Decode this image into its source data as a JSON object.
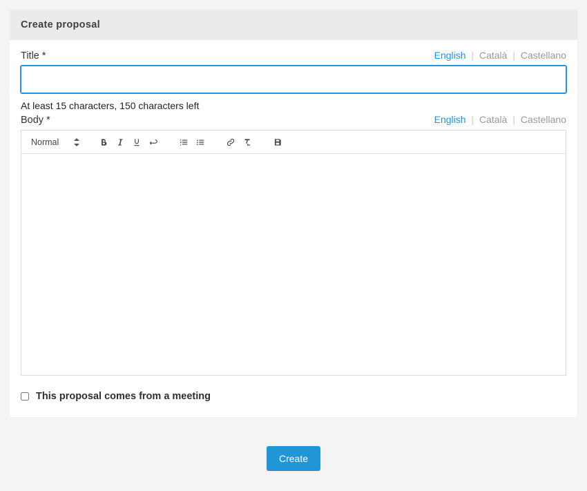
{
  "header": {
    "title": "Create proposal"
  },
  "languages": {
    "items": [
      {
        "label": "English",
        "active": true
      },
      {
        "label": "Català",
        "active": false
      },
      {
        "label": "Castellano",
        "active": false
      }
    ]
  },
  "title_field": {
    "label": "Title *",
    "value": "",
    "help_text": "At least 15 characters, 150 characters left"
  },
  "body_field": {
    "label": "Body *",
    "format_select": "Normal",
    "value": ""
  },
  "meeting_checkbox": {
    "label": "This proposal comes from a meeting",
    "checked": false
  },
  "submit": {
    "label": "Create"
  },
  "toolbar_icons": {
    "bold": "bold-icon",
    "italic": "italic-icon",
    "underline": "underline-icon",
    "break": "linebreak-icon",
    "ordered_list": "ordered-list-icon",
    "unordered_list": "unordered-list-icon",
    "link": "link-icon",
    "clear_format": "clear-format-icon",
    "save": "save-icon"
  }
}
